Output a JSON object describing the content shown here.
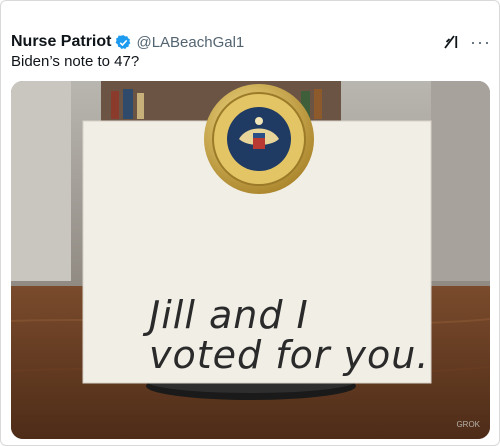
{
  "tweet": {
    "display_name": "Nurse Patriot",
    "handle": "@LABeachGal1",
    "text": "Biden’s note to 47?",
    "more_label": "···"
  },
  "image": {
    "note_line1": "Jill and I",
    "note_line2": "voted for you.",
    "watermark": "GROK"
  },
  "colors": {
    "verified": "#1d9bf0",
    "seal_gold": "#c9a43a",
    "seal_blue": "#1f3b63"
  },
  "icons": [
    "verified-icon",
    "grok-icon",
    "more-icon",
    "presidential-seal-icon"
  ]
}
